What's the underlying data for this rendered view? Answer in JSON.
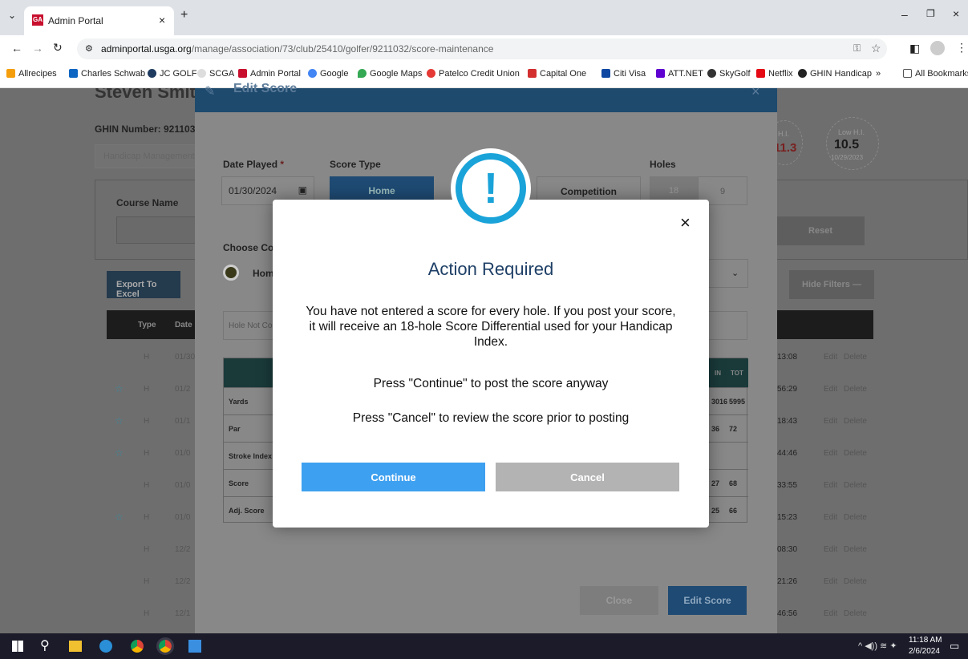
{
  "browser": {
    "tab_title": "Admin Portal",
    "url_host": "adminportal.usga.org",
    "url_path": "/manage/association/73/club/25410/golfer/9211032/score-maintenance",
    "bookmarks": [
      "Allrecipes",
      "Charles Schwab",
      "JC GOLF",
      "SCGA",
      "Admin Portal",
      "Google",
      "Google Maps",
      "Patelco Credit Union",
      "Capital One",
      "Citi Visa",
      "ATT.NET",
      "SkyGolf",
      "Netflix",
      "GHIN Handicap"
    ],
    "all_bookmarks": "All Bookmarks"
  },
  "background": {
    "golfer_name": "Steven Smith",
    "ghin_label": "GHIN Number: 9211032",
    "tab_label": "Handicap Management",
    "course_name_label": "Course Name",
    "export_label": "Export To Excel",
    "reset_label": "Reset",
    "hide_filters_label": "Hide Filters",
    "hi_label": "H.I.",
    "hi_value": "11.3",
    "low_hi_label": "Low H.I.",
    "low_hi_value": "10.5",
    "low_hi_date": "10/29/2023",
    "table_header": [
      "Type",
      "Date"
    ],
    "rows": [
      {
        "type": "H",
        "date": "01/30",
        "time": "13:08",
        "star": false
      },
      {
        "type": "H",
        "date": "01/2",
        "time": "56:29",
        "star": true
      },
      {
        "type": "H",
        "date": "01/1",
        "time": "18:43",
        "star": true
      },
      {
        "type": "H",
        "date": "01/0",
        "time": "44:46",
        "star": true
      },
      {
        "type": "H",
        "date": "01/0",
        "time": "33:55",
        "star": false
      },
      {
        "type": "H",
        "date": "01/0",
        "time": "15:23",
        "star": true
      },
      {
        "type": "H",
        "date": "12/2",
        "time": "08:30",
        "star": false
      },
      {
        "type": "H",
        "date": "12/2",
        "time": "21:26",
        "star": false
      },
      {
        "type": "H",
        "date": "12/1",
        "time": "46:56",
        "star": false
      }
    ],
    "edit_label": "Edit",
    "delete_label": "Delete"
  },
  "edit_modal": {
    "title": "Edit Score",
    "date_played_label": "Date Played",
    "date_played_value": "01/30/2024",
    "score_type_label": "Score Type",
    "score_type_home": "Home",
    "score_type_competition": "Competition",
    "holes_label": "Holes",
    "holes_18": "18",
    "holes_9": "9",
    "choose_course_label": "Choose Cou",
    "home_radio_label": "Hom",
    "hole_not_label": "Hole Not Co",
    "score_rows": [
      "Yards",
      "Par",
      "Stroke Index",
      "Score",
      "Adj. Score"
    ],
    "in_label": "IN",
    "tot_label": "TOT",
    "yards_in": "3016",
    "yards_tot": "5995",
    "par_in": "36",
    "par_tot": "72",
    "score_in": "27",
    "score_tot": "68",
    "adj_in": "25",
    "adj_tot": "66",
    "close_label": "Close",
    "edit_score_label": "Edit Score"
  },
  "action_modal": {
    "title": "Action Required",
    "message": "You have not entered a score for every hole. If you post your score, it will receive an 18-hole Score Differential used for your Handicap Index.",
    "continue_hint": "Press \"Continue\" to post the score anyway",
    "cancel_hint": "Press \"Cancel\" to review the score prior to posting",
    "continue_label": "Continue",
    "cancel_label": "Cancel",
    "close_glyph": "×",
    "colors": {
      "accent": "#1aa3d9",
      "title": "#1e3f66",
      "continue": "#3ea0f0",
      "cancel": "#b3b3b3"
    }
  },
  "taskbar": {
    "time": "11:18 AM",
    "date": "2/6/2024"
  }
}
